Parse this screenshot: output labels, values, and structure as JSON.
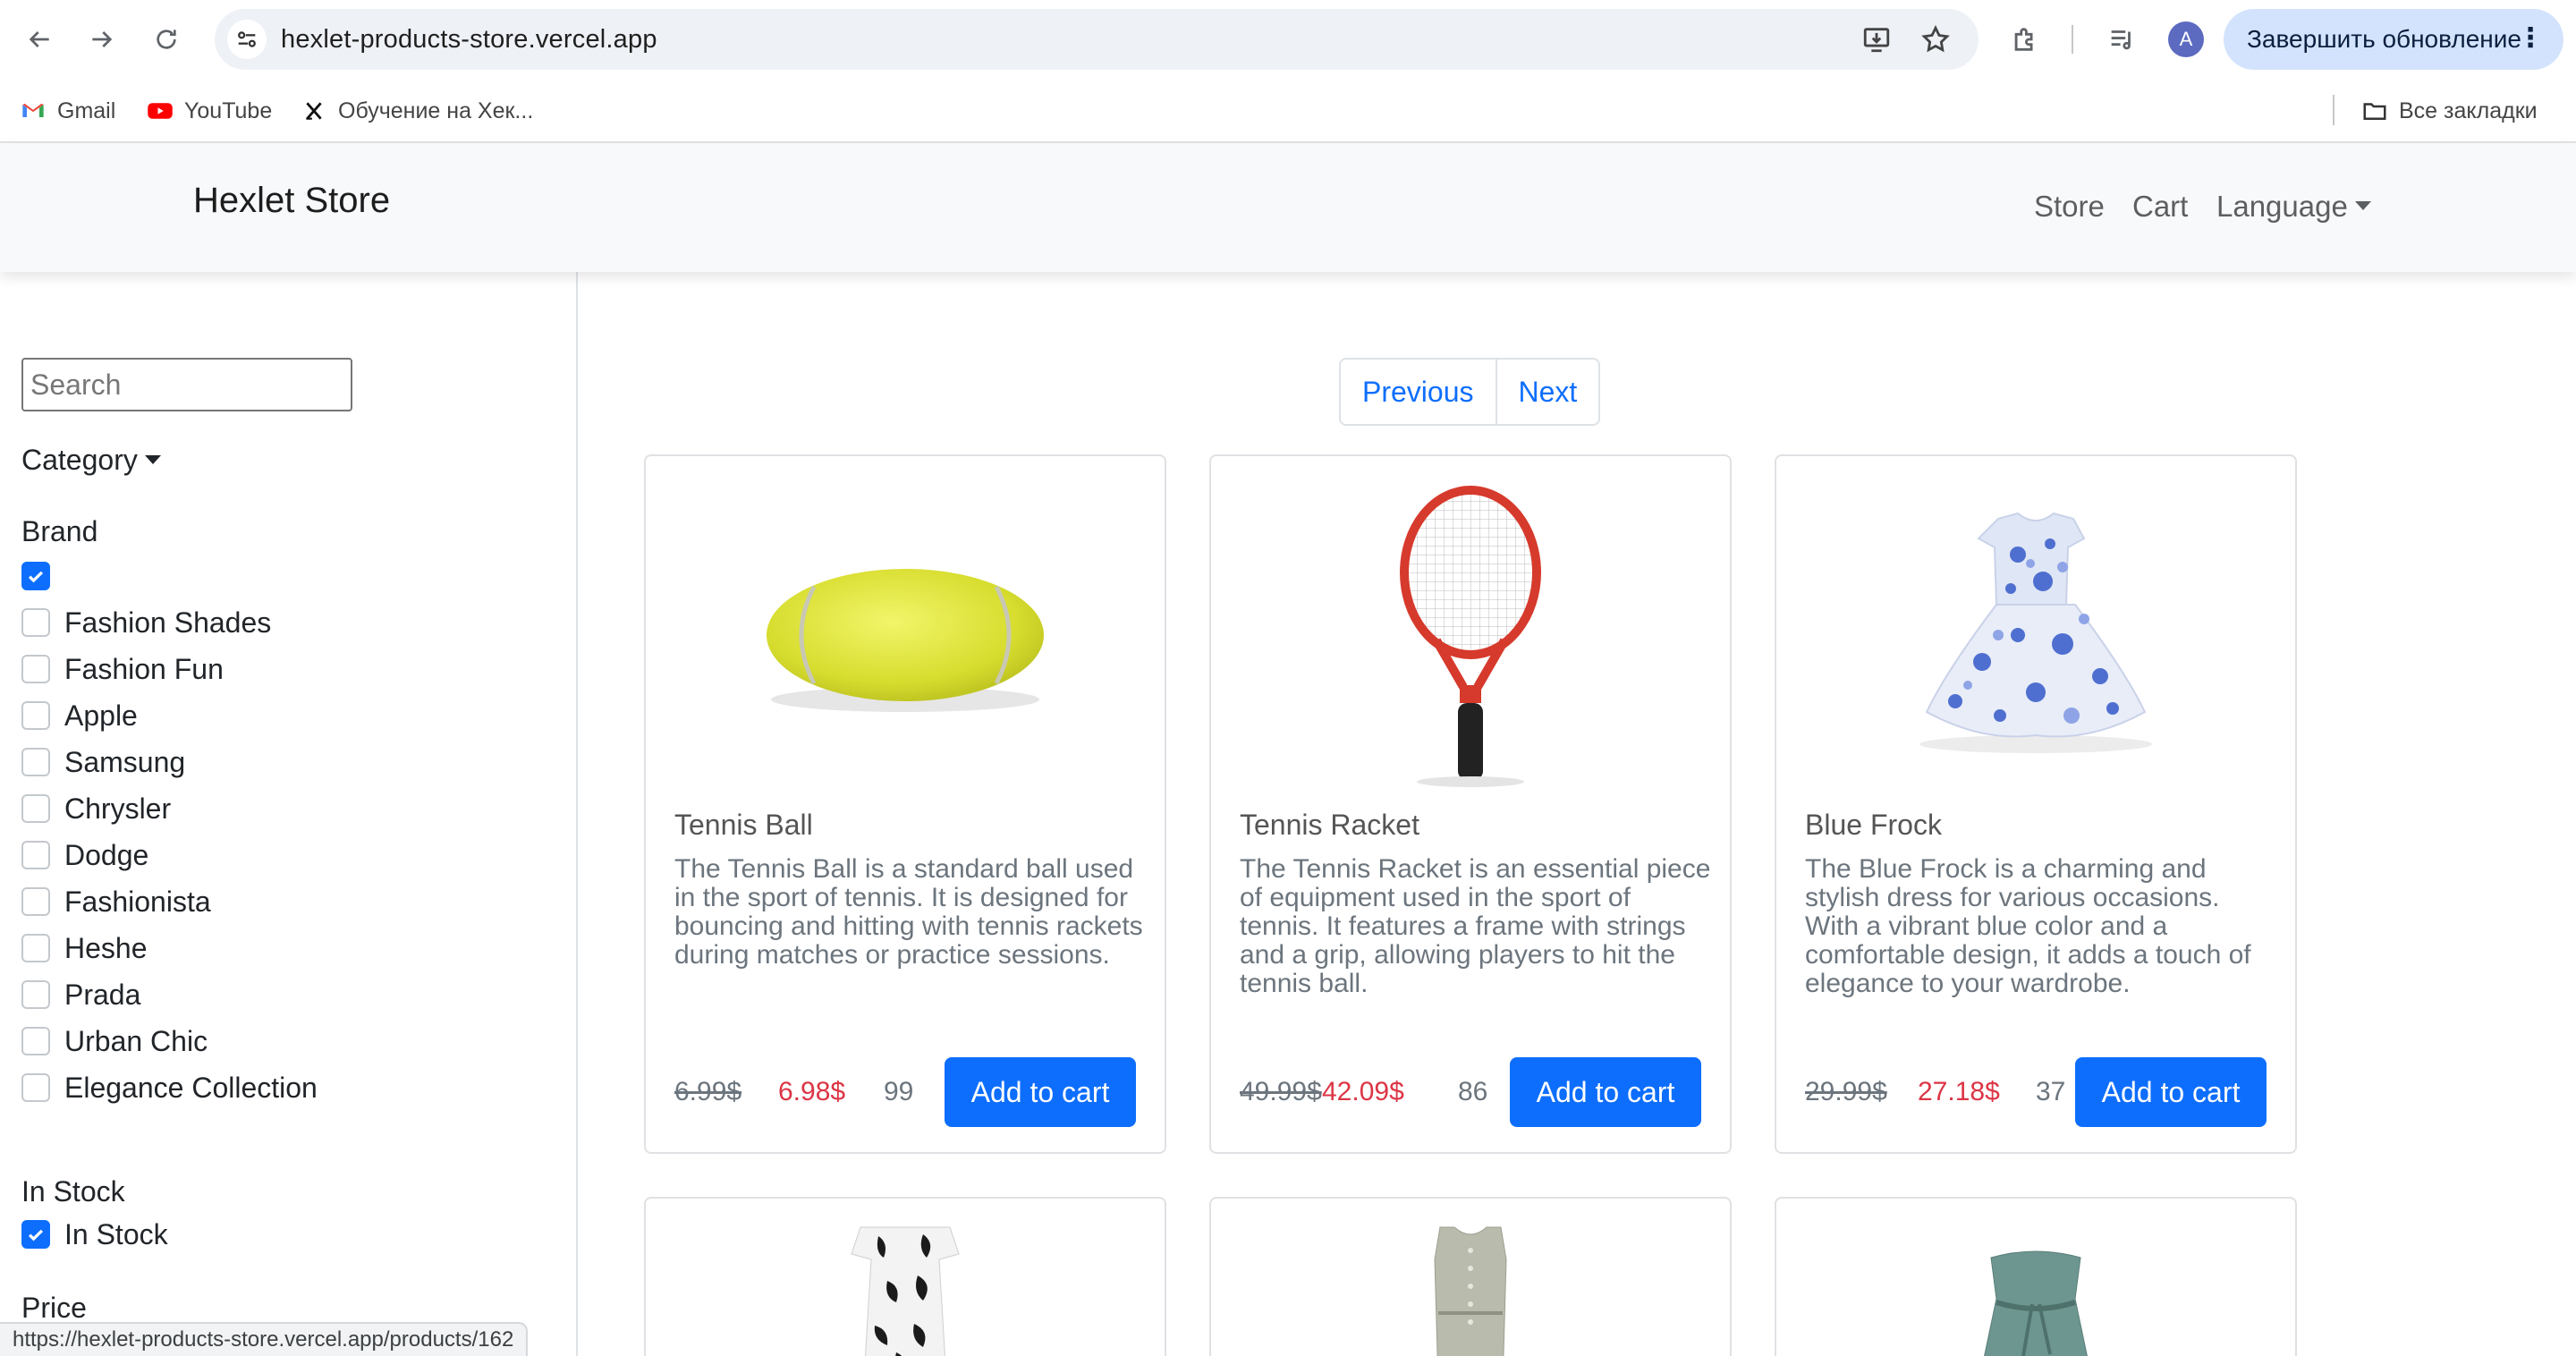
{
  "browser": {
    "url": "hexlet-products-store.vercel.app",
    "update_button_label": "Завершить обновление",
    "avatar_letter": "A",
    "bookmarks": [
      {
        "label": "Gmail"
      },
      {
        "label": "YouTube"
      },
      {
        "label": "Обучение на Хек..."
      }
    ],
    "all_bookmarks_label": "Все закладки",
    "status_url": "https://hexlet-products-store.vercel.app/products/162"
  },
  "navbar": {
    "brand": "Hexlet Store",
    "links": {
      "store": "Store",
      "cart": "Cart",
      "language": "Language"
    }
  },
  "sidebar": {
    "search_placeholder": "Search",
    "category_label": "Category",
    "brand_label": "Brand",
    "brands": [
      {
        "label": "",
        "checked": true
      },
      {
        "label": "Fashion Shades",
        "checked": false
      },
      {
        "label": "Fashion Fun",
        "checked": false
      },
      {
        "label": "Apple",
        "checked": false
      },
      {
        "label": "Samsung",
        "checked": false
      },
      {
        "label": "Chrysler",
        "checked": false
      },
      {
        "label": "Dodge",
        "checked": false
      },
      {
        "label": "Fashionista",
        "checked": false
      },
      {
        "label": "Heshe",
        "checked": false
      },
      {
        "label": "Prada",
        "checked": false
      },
      {
        "label": "Urban Chic",
        "checked": false
      },
      {
        "label": "Elegance Collection",
        "checked": false
      }
    ],
    "in_stock_heading": "In Stock",
    "in_stock_option": {
      "label": "In Stock",
      "checked": true
    },
    "price_label": "Price"
  },
  "pagination": {
    "previous": "Previous",
    "next": "Next"
  },
  "products": [
    {
      "title": "Tennis Ball",
      "description": "The Tennis Ball is a standard ball used in the sport of tennis. It is designed for bouncing and hitting with tennis rackets during matches or practice sessions.",
      "old_price": "6.99$",
      "new_price": "6.98$",
      "stock": "99",
      "button": "Add to cart"
    },
    {
      "title": "Tennis Racket",
      "description": "The Tennis Racket is an essential piece of equipment used in the sport of tennis. It features a frame with strings and a grip, allowing players to hit the tennis ball.",
      "old_price": "49.99$",
      "new_price": "42.09$",
      "stock": "86",
      "button": "Add to cart"
    },
    {
      "title": "Blue Frock",
      "description": "The Blue Frock is a charming and stylish dress for various occasions. With a vibrant blue color and a comfortable design, it adds a touch of elegance to your wardrobe.",
      "old_price": "29.99$",
      "new_price": "27.18$",
      "stock": "37",
      "button": "Add to cart"
    }
  ],
  "colors": {
    "primary": "#0d6efd",
    "sale_price": "#dc3545",
    "navbar_bg": "#f8f9fa"
  }
}
